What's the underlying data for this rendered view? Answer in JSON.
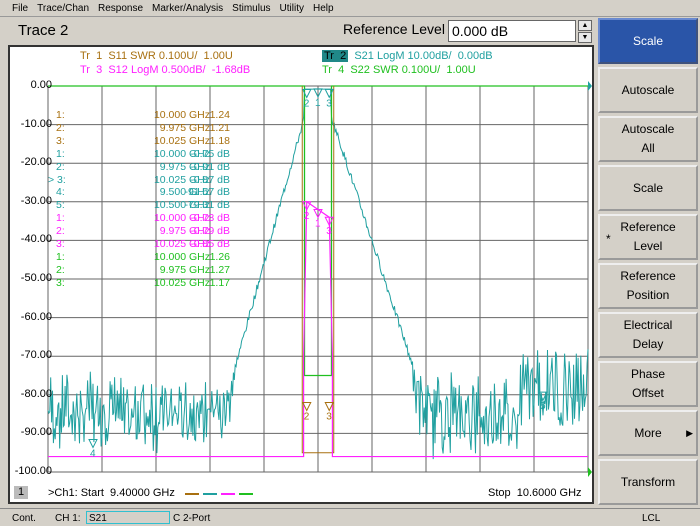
{
  "menu": [
    "File",
    "Trace/Chan",
    "Response",
    "Marker/Analysis",
    "Stimulus",
    "Utility",
    "Help"
  ],
  "toolbar": {
    "title": "Trace 2",
    "ref_label": "Reference Level",
    "ref_value": "0.000 dB"
  },
  "traces": {
    "tr1": {
      "id": "Tr  1",
      "desc": "S11 SWR 0.100U/  1.00U",
      "color": "#a87010"
    },
    "tr2": {
      "id": "Tr  2",
      "desc": "S21 LogM 10.00dB/  0.00dB",
      "color": "#20a0a0"
    },
    "tr3": {
      "id": "Tr  3",
      "desc": "S12 LogM 0.500dB/  -1.68dB",
      "color": "#ff20ff"
    },
    "tr4": {
      "id": "Tr  4",
      "desc": "S22 SWR 0.100U/  1.00U",
      "color": "#20c020"
    }
  },
  "y_axis": [
    "0.00",
    "-10.00",
    "-20.00",
    "-30.00",
    "-40.00",
    "-50.00",
    "-60.00",
    "-70.00",
    "-80.00",
    "-90.00",
    "-100.00"
  ],
  "markers": [
    {
      "n": "1:",
      "f": "10.000 GHz",
      "v": "1.24",
      "c": "#a87010"
    },
    {
      "n": "2:",
      "f": "9.975 GHz",
      "v": "1.21",
      "c": "#a87010"
    },
    {
      "n": "3:",
      "f": "10.025 GHz",
      "v": "1.18",
      "c": "#a87010"
    },
    {
      "n": "1:",
      "f": "10.000 GHz",
      "v": "-0.75 dB",
      "c": "#20a0a0"
    },
    {
      "n": "2:",
      "f": "9.975 GHz",
      "v": "-0.91 dB",
      "c": "#20a0a0"
    },
    {
      "n": "> 3:",
      "f": "10.025 GHz",
      "v": "-0.87 dB",
      "c": "#20a0a0"
    },
    {
      "n": "4:",
      "f": "9.500 GHz",
      "v": "-91.57 dB",
      "c": "#20a0a0"
    },
    {
      "n": "5:",
      "f": "10.500 GHz",
      "v": "-79.31 dB",
      "c": "#20a0a0"
    },
    {
      "n": "1:",
      "f": "10.000 GHz",
      "v": "-0.73 dB",
      "c": "#ff20ff"
    },
    {
      "n": "2:",
      "f": "9.975 GHz",
      "v": "-0.79 dB",
      "c": "#ff20ff"
    },
    {
      "n": "3:",
      "f": "10.025 GHz",
      "v": "-0.85 dB",
      "c": "#ff20ff"
    },
    {
      "n": "1:",
      "f": "10.000 GHz",
      "v": "1.26",
      "c": "#20c020"
    },
    {
      "n": "2:",
      "f": "9.975 GHz",
      "v": "1.27",
      "c": "#20c020"
    },
    {
      "n": "3:",
      "f": "10.025 GHz",
      "v": "1.17",
      "c": "#20c020"
    }
  ],
  "footer": {
    "channel": "1",
    "start": ">Ch1: Start  9.40000 GHz",
    "stop": "Stop  10.6000 GHz"
  },
  "softkeys": [
    {
      "label": "Scale",
      "active": true
    },
    {
      "label": "Autoscale"
    },
    {
      "label": "Autoscale\nAll"
    },
    {
      "label": "Scale"
    },
    {
      "label": "Reference\nLevel",
      "star": "*"
    },
    {
      "label": "Reference\nPosition"
    },
    {
      "label": "Electrical\nDelay"
    },
    {
      "label": "Phase\nOffset"
    },
    {
      "label": "More",
      "arrow": "▶"
    },
    {
      "label": "Transform"
    }
  ],
  "status": {
    "mode": "Cont.",
    "channel": "CH 1:",
    "param": "S21",
    "cal": "C  2-Port",
    "remote": "LCL"
  }
}
